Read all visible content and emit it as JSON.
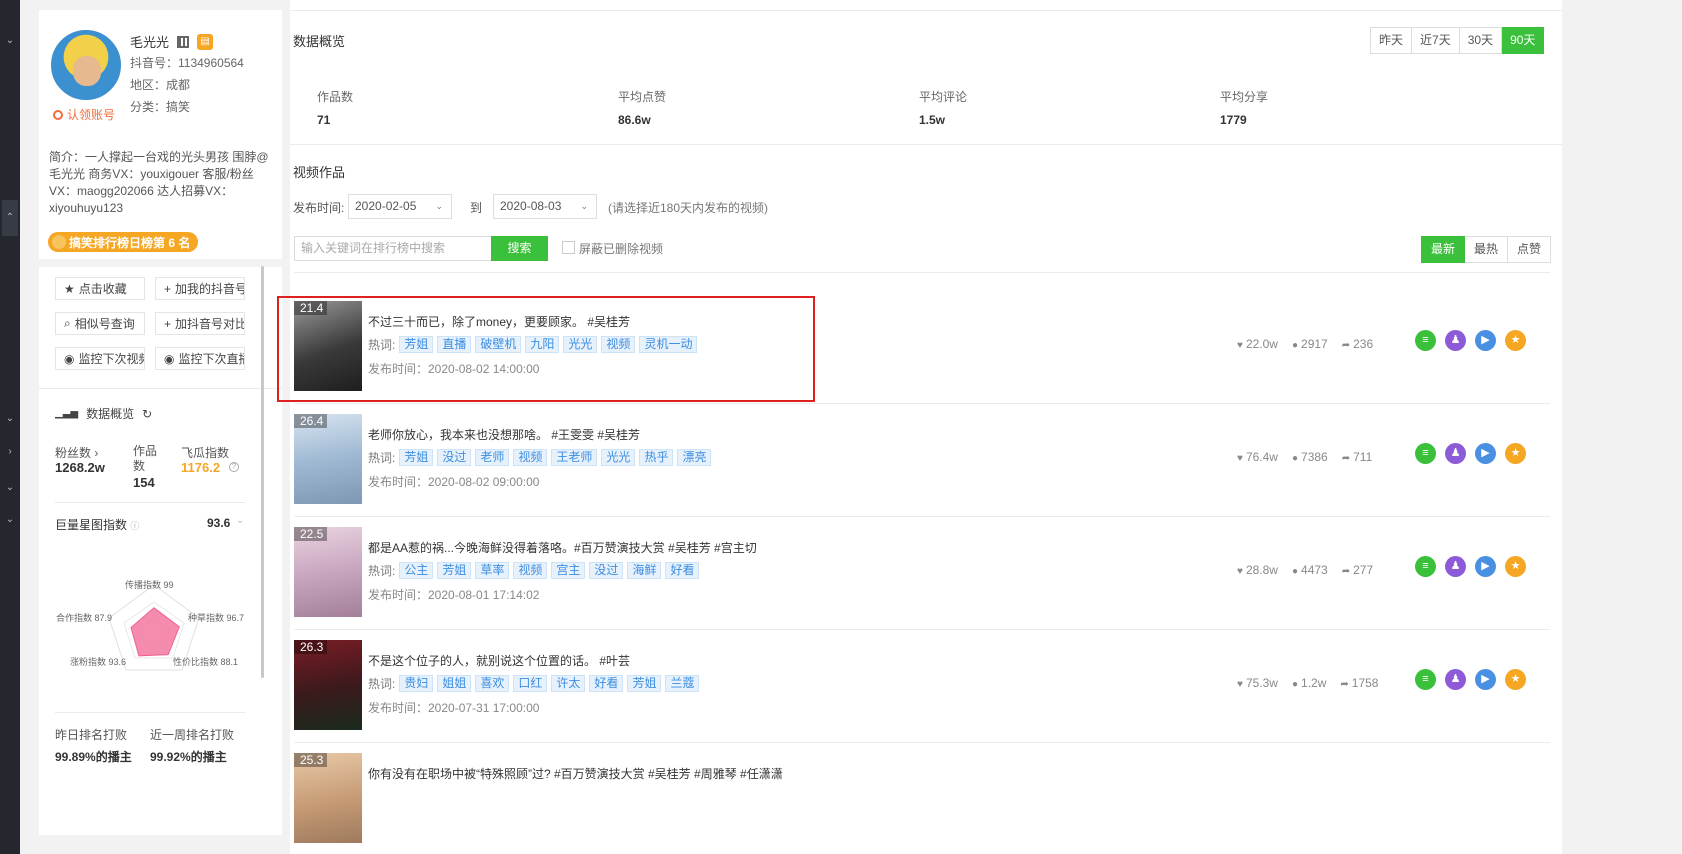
{
  "profile": {
    "name": "毛光光",
    "douyin_id": "抖音号：1134960564",
    "region": "地区：成都",
    "category": "分类：搞笑",
    "claim": "认领账号",
    "intro": "简介：一人撑起一台戏的光头男孩 围脖@毛光光 商务VX：youxigouer 客服/粉丝VX：maogg202066 达人招募VX：xiyouhuyu123",
    "rank_badge": "搞笑排行榜日榜第 6 名"
  },
  "actions": {
    "favorite": "点击收藏",
    "add_mine": "加我的抖音号",
    "similar": "相似号查询",
    "add_compare": "加抖音号对比",
    "monitor_video": "监控下次视频",
    "monitor_live": "监控下次直播"
  },
  "overview_side": {
    "title": "数据概览",
    "fans_label": "粉丝数",
    "fans_value": "1268.2w",
    "works_label": "作品数",
    "works_value": "154",
    "feigua_label": "飞瓜指数",
    "feigua_value": "1176.2",
    "star_label": "巨量星图指数",
    "star_value": "93.6",
    "radar": {
      "spread": "传播指数 99",
      "grass": "种草指数 96.7",
      "value": "性价比指数 88.1",
      "fans": "涨粉指数 93.6",
      "coop": "合作指数 87.9",
      "scores": [
        99,
        96.7,
        88.1,
        93.6,
        87.9
      ]
    },
    "yesterday_label": "昨日排名打败",
    "yesterday_value": "99.89%的播主",
    "week_label": "近一周排名打败",
    "week_value": "99.92%的播主"
  },
  "main": {
    "overview_title": "数据概览",
    "periods": [
      "昨天",
      "近7天",
      "30天",
      "90天"
    ],
    "active_period": "90天",
    "stats": [
      {
        "label": "作品数",
        "value": "71"
      },
      {
        "label": "平均点赞",
        "value": "86.6w"
      },
      {
        "label": "平均评论",
        "value": "1.5w"
      },
      {
        "label": "平均分享",
        "value": "1779"
      }
    ],
    "videos_title": "视频作品",
    "date_label": "发布时间:",
    "date_from": "2020-02-05",
    "to_label": "到",
    "date_to": "2020-08-03",
    "date_hint": "(请选择近180天内发布的视频)",
    "search_placeholder": "输入关键词在排行榜中搜索",
    "search_button": "搜索",
    "hide_deleted": "屏蔽已删除视频",
    "sorts": [
      "最新",
      "最热",
      "点赞"
    ],
    "active_sort": "最新"
  },
  "videos": [
    {
      "score": "21.4",
      "title": "不过三十而已，除了money，更要顾家。 #吴桂芳",
      "hot_label": "热词:",
      "tags": [
        "芳姐",
        "直播",
        "破壁机",
        "九阳",
        "光光",
        "视频",
        "灵机一动"
      ],
      "pub": "发布时间：2020-08-02 14:00:00",
      "likes": "22.0w",
      "comments": "2917",
      "shares": "236"
    },
    {
      "score": "26.4",
      "title": "老师你放心，我本来也没想那啥。 #王雯雯 #吴桂芳",
      "hot_label": "热词:",
      "tags": [
        "芳姐",
        "没过",
        "老师",
        "视频",
        "王老师",
        "光光",
        "热乎",
        "漂亮"
      ],
      "pub": "发布时间：2020-08-02 09:00:00",
      "likes": "76.4w",
      "comments": "7386",
      "shares": "711"
    },
    {
      "score": "22.5",
      "title": "都是AA惹的祸...今晚海鲜没得着落咯。#百万赞演技大赏 #吴桂芳 #宫主切",
      "hot_label": "热词:",
      "tags": [
        "公主",
        "芳姐",
        "草率",
        "视频",
        "宫主",
        "没过",
        "海鲜",
        "好看"
      ],
      "pub": "发布时间：2020-08-01 17:14:02",
      "likes": "28.8w",
      "comments": "4473",
      "shares": "277"
    },
    {
      "score": "26.3",
      "title": "不是这个位子的人，就别说这个位置的话。 #叶芸",
      "hot_label": "热词:",
      "tags": [
        "贵妇",
        "姐姐",
        "喜欢",
        "口红",
        "许太",
        "好看",
        "芳姐",
        "兰蔻"
      ],
      "pub": "发布时间：2020-07-31 17:00:00",
      "likes": "75.3w",
      "comments": "1.2w",
      "shares": "1758"
    },
    {
      "score": "25.3",
      "title": "你有没有在职场中被“特殊照顾”过? #百万赞演技大赏 #吴桂芳 #周雅琴 #任潇潇",
      "hot_label": "",
      "tags": [],
      "pub": "",
      "likes": "",
      "comments": "",
      "shares": ""
    }
  ],
  "colors": {
    "accent": "#3ac03a",
    "orange": "#f5a623",
    "link": "#3c8ee0",
    "highlight": "#e02020"
  }
}
